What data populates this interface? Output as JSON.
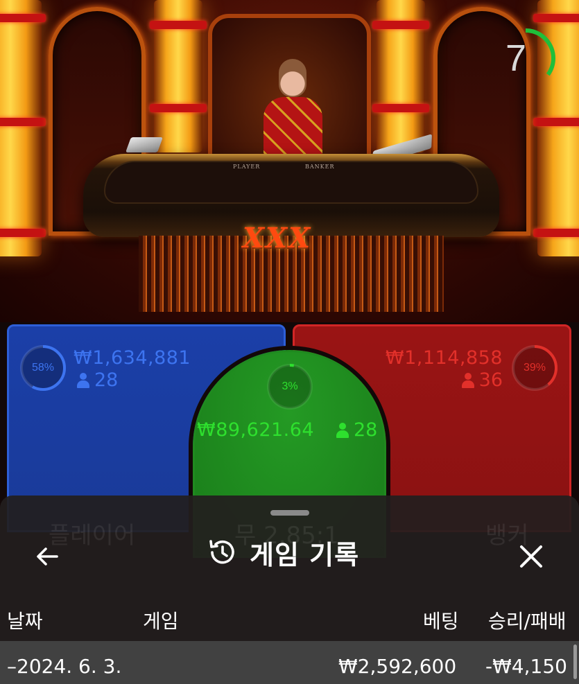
{
  "scene": {
    "table_logo": "XXX",
    "felt_labels": {
      "player": "PLAYER",
      "banker": "BANKER"
    },
    "timer": {
      "seconds": "7",
      "remaining_fraction": 0.35,
      "color": "#1fbf3a"
    }
  },
  "bets": {
    "player": {
      "percent": "58%",
      "percent_value": 0.58,
      "amount": "₩1,634,881",
      "users": "28",
      "color": "#3d74f0"
    },
    "banker": {
      "percent": "39%",
      "percent_value": 0.39,
      "amount": "₩1,114,858",
      "users": "36",
      "color": "#e2302a"
    },
    "tie": {
      "percent": "3%",
      "percent_value": 0.03,
      "amount": "₩89,621.64",
      "users": "28",
      "color": "#2ee02e"
    }
  },
  "sheet": {
    "title": "게임 기록",
    "title_icon": "history-icon",
    "back_icon": "back-arrow-icon",
    "close_icon": "close-icon",
    "background_labels": {
      "player": "플레이어",
      "odds": "무 2.85:1",
      "banker": "뱅커"
    },
    "columns": {
      "date": "날짜",
      "game": "게임",
      "bet": "베팅",
      "result": "승리/패배"
    },
    "rows": [
      {
        "prefix": "–",
        "date": "2024. 6. 3.",
        "bet": "₩2,592,600",
        "result": "-₩4,150"
      }
    ]
  }
}
